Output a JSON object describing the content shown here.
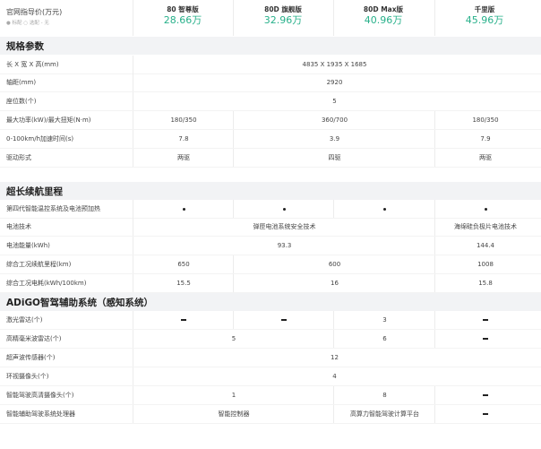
{
  "header": {
    "label": "官网指导价(万元)",
    "note": "● 标配 ○ 选配 - 无",
    "variants": [
      {
        "name": "80 智尊版",
        "price": "28.66万"
      },
      {
        "name": "80D 旗舰版",
        "price": "32.96万"
      },
      {
        "name": "80D Max版",
        "price": "40.96万"
      },
      {
        "name": "千里版",
        "price": "45.96万"
      }
    ]
  },
  "accent_color": "#27b08a",
  "sections": {
    "specs": "规格参数",
    "range": "超长续航里程",
    "adas": "ADiGO智驾辅助系统（感知系统）"
  },
  "specs": {
    "dimensions": {
      "label": "长 X 宽 X 高(mm)",
      "value": "4835 X 1935 X 1685"
    },
    "wheelbase": {
      "label": "轴距(mm)",
      "value": "2920"
    },
    "seats": {
      "label": "座位数(个)",
      "value": "5"
    },
    "power": {
      "label": "最大功率(kW)/最大扭矩(N·m)",
      "v1": "180/350",
      "v23": "360/700",
      "v4": "180/350"
    },
    "accel": {
      "label": "0-100km/h加速时间(s)",
      "v1": "7.8",
      "v23": "3.9",
      "v4": "7.9"
    },
    "drive": {
      "label": "驱动形式",
      "v1": "两驱",
      "v23": "四驱",
      "v4": "两驱"
    }
  },
  "range": {
    "thermal": {
      "label": "第四代智能温控系统及电池预加热",
      "icon": "standard-dot-icon"
    },
    "battery_tech": {
      "label": "电池技术",
      "v123": "弹匣电池系统安全技术",
      "v4": "海绵硅负极片电池技术"
    },
    "battery_energy": {
      "label": "电池能量(kWh)",
      "v123": "93.3",
      "v4": "144.4"
    },
    "wltc_range": {
      "label": "综合工况续航里程(km)",
      "v1": "650",
      "v23": "600",
      "v4": "1008"
    },
    "consumption": {
      "label": "综合工况电耗(kWh/100km)",
      "v1": "15.5",
      "v23": "16",
      "v4": "15.8"
    }
  },
  "adas": {
    "lidar": {
      "label": "激光雷达(个)",
      "v3": "3"
    },
    "mmwave": {
      "label": "高精毫米波雷达(个)",
      "v12": "5",
      "v3": "6"
    },
    "ultrasonic": {
      "label": "超声波传感器(个)",
      "v": "12"
    },
    "surround_cam": {
      "label": "环视摄像头(个)",
      "v": "4"
    },
    "adas_cam": {
      "label": "智能驾驶高清摄像头(个)",
      "v12": "1",
      "v3": "8"
    },
    "processor": {
      "label": "智能辅助驾驶系统处理器",
      "v12": "智能控制器",
      "v3": "高算力智能驾驶计算平台"
    }
  },
  "not_available_icon": "dash-icon"
}
